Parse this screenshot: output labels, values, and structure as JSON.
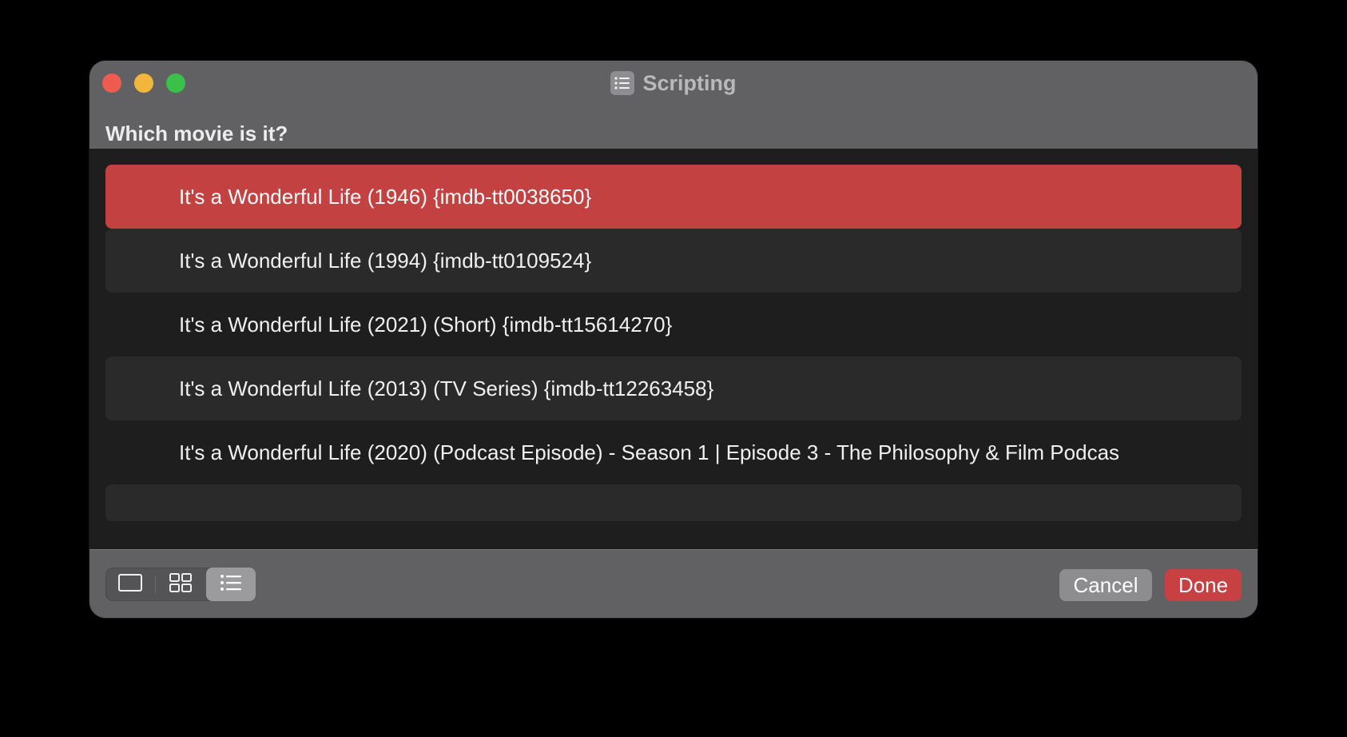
{
  "window": {
    "title": "Scripting",
    "title_icon": "list-icon"
  },
  "prompt": "Which movie is it?",
  "list": {
    "items": [
      {
        "label": "It's a Wonderful Life (1946) {imdb-tt0038650}",
        "selected": true
      },
      {
        "label": "It's a Wonderful Life (1994) {imdb-tt0109524}",
        "selected": false
      },
      {
        "label": "It's a Wonderful Life (2021) (Short) {imdb-tt15614270}",
        "selected": false
      },
      {
        "label": "It's a Wonderful Life (2013) (TV Series) {imdb-tt12263458}",
        "selected": false
      },
      {
        "label": "It's a Wonderful Life (2020) (Podcast Episode) - Season 1 | Episode 3 - The Philosophy & Film Podcas",
        "selected": false
      }
    ]
  },
  "view_switcher": {
    "options": [
      "single-view-icon",
      "grid-view-icon",
      "list-view-icon"
    ],
    "selected": "list-view-icon"
  },
  "buttons": {
    "cancel": "Cancel",
    "done": "Done"
  },
  "colors": {
    "accent": "#c44142",
    "close": "#ee5b51",
    "minimize": "#f3b63c",
    "maximize": "#3bc14a"
  }
}
